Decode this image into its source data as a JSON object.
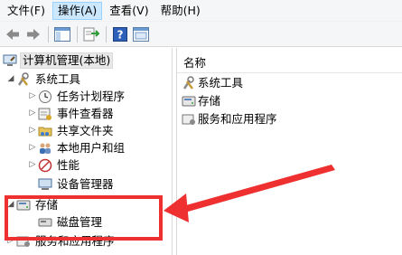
{
  "menubar": {
    "items": [
      {
        "label": "文件(F)",
        "active": false
      },
      {
        "label": "操作(A)",
        "active": true
      },
      {
        "label": "查看(V)",
        "active": false
      },
      {
        "label": "帮助(H)",
        "active": false
      }
    ]
  },
  "toolbar": {
    "icons": [
      "back-arrow-icon",
      "forward-arrow-icon",
      "show-hide-tree-icon",
      "export-list-icon",
      "help-icon",
      "properties-icon"
    ]
  },
  "tree": {
    "root": "计算机管理(本地)",
    "system_tools": "系统工具",
    "task_scheduler": "任务计划程序",
    "event_viewer": "事件查看器",
    "shared_folders": "共享文件夹",
    "local_users": "本地用户和组",
    "performance": "性能",
    "device_manager": "设备管理器",
    "storage": "存储",
    "disk_management": "磁盘管理",
    "services_apps": "服务和应用程序"
  },
  "right": {
    "column_header": "名称",
    "items": [
      "系统工具",
      "存储",
      "服务和应用程序"
    ]
  },
  "colors": {
    "annotation": "#ee3030",
    "menu_active": "#cce8ff"
  }
}
